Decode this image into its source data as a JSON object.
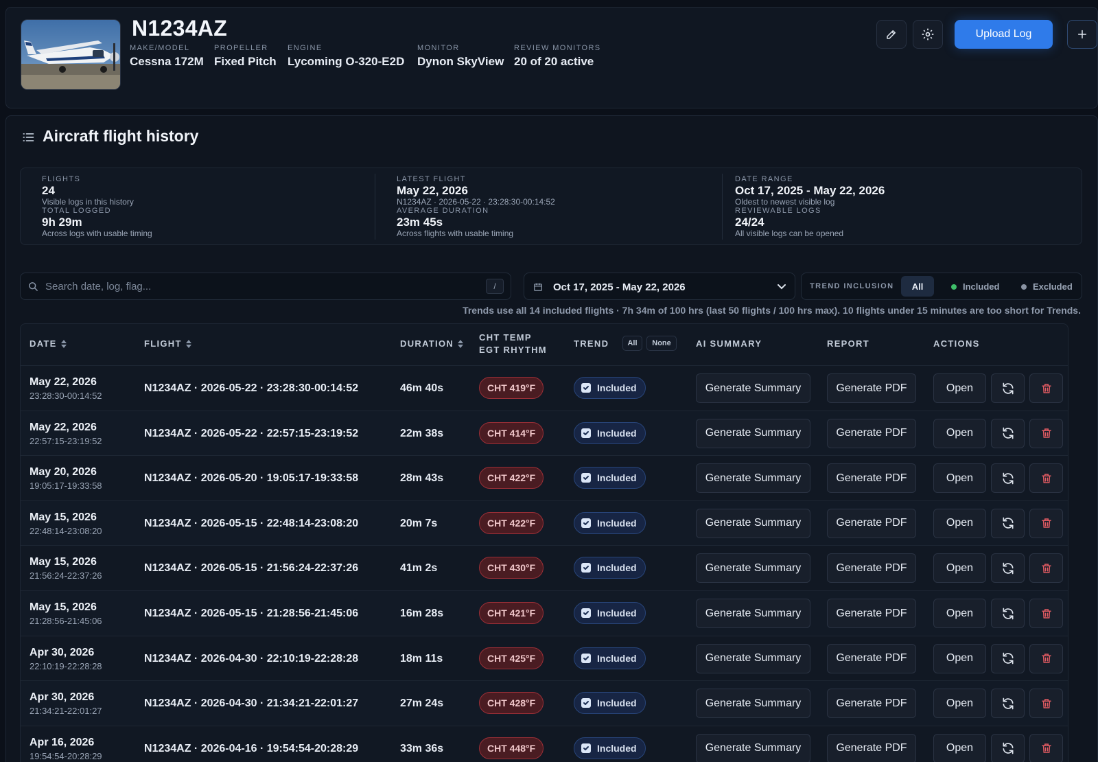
{
  "aircraft": {
    "tail": "N1234AZ",
    "fields": [
      {
        "label": "MAKE/MODEL",
        "value": "Cessna 172M"
      },
      {
        "label": "PROPELLER",
        "value": "Fixed Pitch"
      },
      {
        "label": "ENGINE",
        "value": "Lycoming O-320-E2D"
      },
      {
        "label": "MONITOR",
        "value": "Dynon SkyView"
      },
      {
        "label": "REVIEW MONITORS",
        "value": "20 of 20 active"
      }
    ],
    "upload_label": "Upload Log",
    "icons": [
      "pencil-icon",
      "gear-icon",
      "plus-icon"
    ]
  },
  "history": {
    "title": "Aircraft flight history",
    "stats": [
      {
        "label": "FLIGHTS",
        "value": "24",
        "sub": "Visible logs in this history"
      },
      {
        "label": "TOTAL LOGGED",
        "value": "9h 29m",
        "sub": "Across logs with usable timing"
      },
      {
        "label": "LATEST FLIGHT",
        "value": "May 22, 2026",
        "sub": "N1234AZ · 2026-05-22 · 23:28:30-00:14:52"
      },
      {
        "label": "AVERAGE DURATION",
        "value": "23m 45s",
        "sub": "Across flights with usable timing"
      },
      {
        "label": "DATE RANGE",
        "value": "Oct 17, 2025 - May 22, 2026",
        "sub": "Oldest to newest visible log"
      },
      {
        "label": "REVIEWABLE LOGS",
        "value": "24/24",
        "sub": "All visible logs can be opened"
      }
    ],
    "search_placeholder": "Search date, log, flag...",
    "search_shortcut": "/",
    "date_range": "Oct 17, 2025 - May 22, 2026",
    "trend_inclusion": {
      "label": "TREND INCLUSION",
      "all": "All",
      "included": "Included",
      "excluded": "Excluded"
    },
    "note": "Trends use all 14 included flights · 7h 34m of 100 hrs (last 50 flights / 100 hrs max). 10 flights under 15 minutes are too short for Trends.",
    "columns": {
      "date": "DATE",
      "flight": "FLIGHT",
      "duration": "DURATION",
      "cht1": "CHT TEMP",
      "cht2": "EGT RHYTHM",
      "trend": "TREND",
      "trend_all": "All",
      "trend_none": "None",
      "ai": "AI SUMMARY",
      "report": "REPORT",
      "actions": "ACTIONS"
    },
    "labels": {
      "included": "Included",
      "summary": "Generate Summary",
      "pdf": "Generate PDF",
      "open": "Open"
    },
    "rows": [
      {
        "date": "May 22, 2026",
        "time": "23:28:30-00:14:52",
        "flight": "N1234AZ · 2026-05-22 · 23:28:30-00:14:52",
        "duration": "46m 40s",
        "cht": "CHT 419°F"
      },
      {
        "date": "May 22, 2026",
        "time": "22:57:15-23:19:52",
        "flight": "N1234AZ · 2026-05-22 · 22:57:15-23:19:52",
        "duration": "22m 38s",
        "cht": "CHT 414°F"
      },
      {
        "date": "May 20, 2026",
        "time": "19:05:17-19:33:58",
        "flight": "N1234AZ · 2026-05-20 · 19:05:17-19:33:58",
        "duration": "28m 43s",
        "cht": "CHT 422°F"
      },
      {
        "date": "May 15, 2026",
        "time": "22:48:14-23:08:20",
        "flight": "N1234AZ · 2026-05-15 · 22:48:14-23:08:20",
        "duration": "20m 7s",
        "cht": "CHT 422°F"
      },
      {
        "date": "May 15, 2026",
        "time": "21:56:24-22:37:26",
        "flight": "N1234AZ · 2026-05-15 · 21:56:24-22:37:26",
        "duration": "41m 2s",
        "cht": "CHT 430°F"
      },
      {
        "date": "May 15, 2026",
        "time": "21:28:56-21:45:06",
        "flight": "N1234AZ · 2026-05-15 · 21:28:56-21:45:06",
        "duration": "16m 28s",
        "cht": "CHT 421°F"
      },
      {
        "date": "Apr 30, 2026",
        "time": "22:10:19-22:28:28",
        "flight": "N1234AZ · 2026-04-30 · 22:10:19-22:28:28",
        "duration": "18m 11s",
        "cht": "CHT 425°F"
      },
      {
        "date": "Apr 30, 2026",
        "time": "21:34:21-22:01:27",
        "flight": "N1234AZ · 2026-04-30 · 21:34:21-22:01:27",
        "duration": "27m 24s",
        "cht": "CHT 428°F"
      },
      {
        "date": "Apr 16, 2026",
        "time": "19:54:54-20:28:29",
        "flight": "N1234AZ · 2026-04-16 · 19:54:54-20:28:29",
        "duration": "33m 36s",
        "cht": "CHT 448°F"
      }
    ]
  },
  "colors": {
    "accent": "#2f7bea",
    "included_dot": "#3fbf6a",
    "excluded_dot": "#8a93a3",
    "cht_badge": "#9b2f37"
  }
}
